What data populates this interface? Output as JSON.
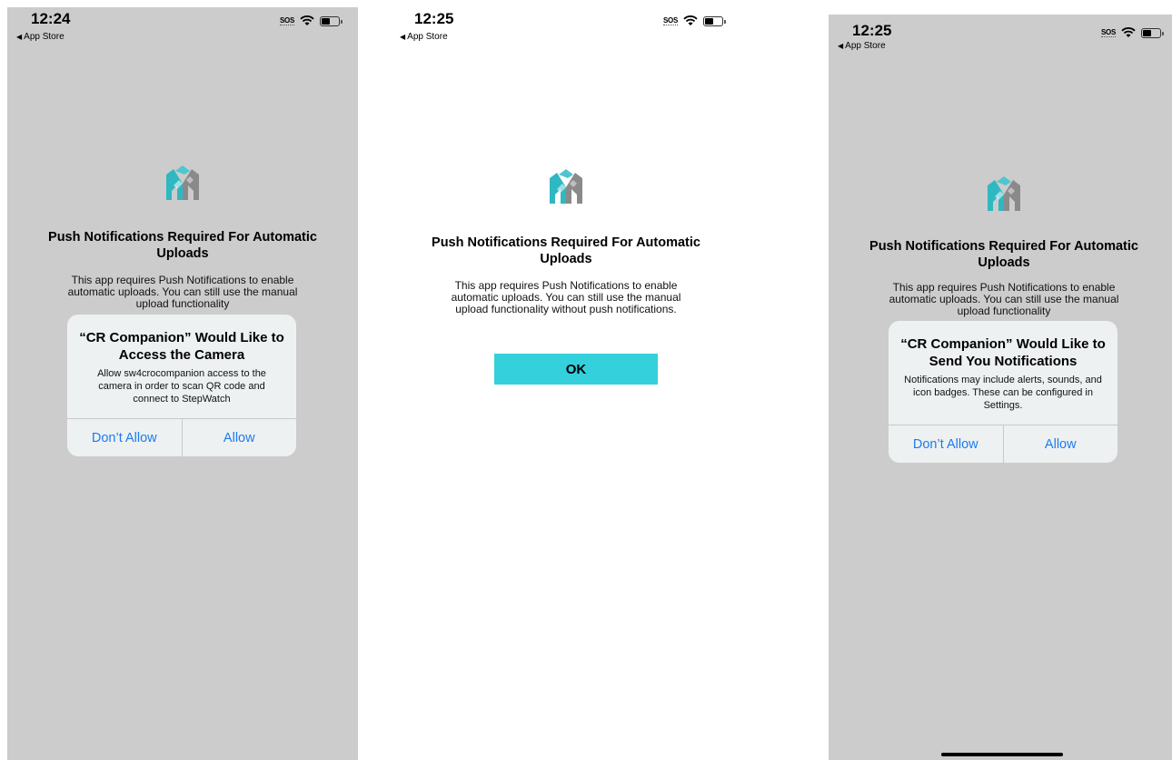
{
  "screens": [
    {
      "status": {
        "time": "12:24",
        "back": "App Store",
        "sos": "SOS"
      },
      "title": "Push Notifications Required For Automatic Uploads",
      "body": "This app requires Push Notifications to enable automatic uploads.  You can still use the manual upload functionality",
      "alert": {
        "title": "“CR Companion” Would Like to Access the Camera",
        "message": "Allow sw4crocompanion access to the camera in order to scan QR code and connect to StepWatch",
        "deny_label": "Don’t Allow",
        "allow_label": "Allow"
      }
    },
    {
      "status": {
        "time": "12:25",
        "back": "App Store",
        "sos": "SOS"
      },
      "title": "Push Notifications Required For Automatic Uploads",
      "body": "This app requires Push Notifications to enable automatic uploads.  You can still use the manual upload functionality without push notifications.",
      "ok_label": "OK"
    },
    {
      "status": {
        "time": "12:25",
        "back": "App Store",
        "sos": "SOS"
      },
      "title": "Push Notifications Required For Automatic Uploads",
      "body": "This app requires Push Notifications to enable automatic uploads.  You can still use the manual upload functionality",
      "alert": {
        "title": "“CR Companion” Would Like to Send You Notifications",
        "message": "Notifications may include alerts, sounds, and icon badges. These can be configured in Settings.",
        "deny_label": "Don’t Allow",
        "allow_label": "Allow"
      }
    }
  ],
  "icons": {
    "logo": "app-logo-icon",
    "wifi": "wifi-icon",
    "battery": "battery-icon",
    "back": "back-triangle-icon"
  },
  "colors": {
    "dim_background": "#cccccc",
    "ok_button": "#34d0db",
    "alert_button_text": "#1a7cf0",
    "logo_teal": "#2fb8c2",
    "logo_gray": "#8a8a8a"
  }
}
